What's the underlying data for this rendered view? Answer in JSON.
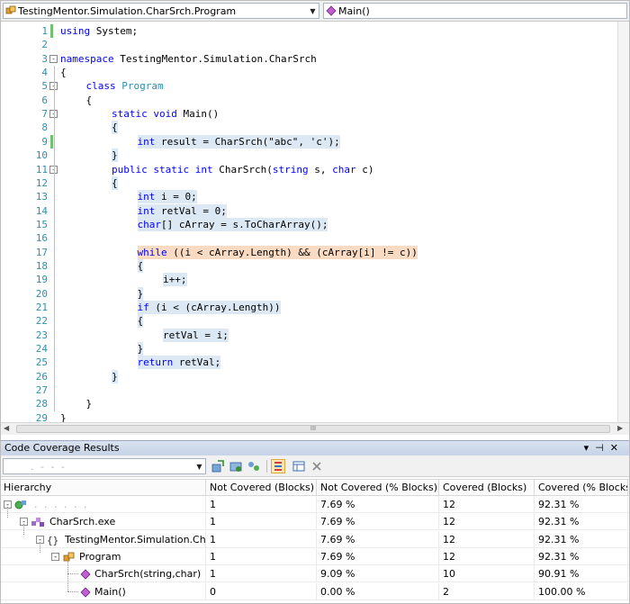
{
  "navbar": {
    "type_selector": "TestingMentor.Simulation.CharSrch.Program",
    "member_selector": "Main()"
  },
  "editor": {
    "lines": [
      {
        "n": "1",
        "text": "using System;",
        "indent": 0,
        "cov": "none"
      },
      {
        "n": "2",
        "text": "",
        "indent": 0,
        "cov": "none"
      },
      {
        "n": "3",
        "text": "namespace TestingMentor.Simulation.CharSrch",
        "indent": 0,
        "cov": "none"
      },
      {
        "n": "4",
        "text": "{",
        "indent": 0,
        "cov": "none"
      },
      {
        "n": "5",
        "text": "class Program",
        "indent": 1,
        "cov": "none"
      },
      {
        "n": "6",
        "text": "{",
        "indent": 1,
        "cov": "none"
      },
      {
        "n": "7",
        "text": "static void Main()",
        "indent": 2,
        "cov": "none"
      },
      {
        "n": "8",
        "text": "{",
        "indent": 2,
        "cov": "covered"
      },
      {
        "n": "9",
        "text": "int result = CharSrch(\"abc\", 'c');",
        "indent": 3,
        "cov": "covered"
      },
      {
        "n": "10",
        "text": "}",
        "indent": 2,
        "cov": "covered"
      },
      {
        "n": "11",
        "text": "public static int CharSrch(string s, char c)",
        "indent": 2,
        "cov": "none"
      },
      {
        "n": "12",
        "text": "{",
        "indent": 2,
        "cov": "covered"
      },
      {
        "n": "13",
        "text": "int i = 0;",
        "indent": 3,
        "cov": "covered"
      },
      {
        "n": "14",
        "text": "int retVal = 0;",
        "indent": 3,
        "cov": "covered"
      },
      {
        "n": "15",
        "text": "char[] cArray = s.ToCharArray();",
        "indent": 3,
        "cov": "covered"
      },
      {
        "n": "16",
        "text": "",
        "indent": 0,
        "cov": "none"
      },
      {
        "n": "17",
        "text": "while ((i < cArray.Length) && (cArray[i] != c))",
        "indent": 3,
        "cov": "partial"
      },
      {
        "n": "18",
        "text": "{",
        "indent": 3,
        "cov": "covered"
      },
      {
        "n": "19",
        "text": "i++;",
        "indent": 4,
        "cov": "covered"
      },
      {
        "n": "20",
        "text": "}",
        "indent": 3,
        "cov": "covered"
      },
      {
        "n": "21",
        "text": "if (i < (cArray.Length))",
        "indent": 3,
        "cov": "covered"
      },
      {
        "n": "22",
        "text": "{",
        "indent": 3,
        "cov": "covered"
      },
      {
        "n": "23",
        "text": "retVal = i;",
        "indent": 4,
        "cov": "covered"
      },
      {
        "n": "24",
        "text": "}",
        "indent": 3,
        "cov": "covered"
      },
      {
        "n": "25",
        "text": "return retVal;",
        "indent": 3,
        "cov": "covered"
      },
      {
        "n": "26",
        "text": "}",
        "indent": 2,
        "cov": "covered"
      },
      {
        "n": "27",
        "text": "",
        "indent": 0,
        "cov": "none"
      },
      {
        "n": "28",
        "text": "}",
        "indent": 1,
        "cov": "none"
      },
      {
        "n": "29",
        "text": "}",
        "indent": 0,
        "cov": "none"
      }
    ]
  },
  "coverage": {
    "title": "Code Coverage Results",
    "toolbar_combo": ". - - -",
    "columns": [
      "Hierarchy",
      "Not Covered (Blocks)",
      "Not Covered (% Blocks)",
      "Covered (Blocks)",
      "Covered (% Blocks)"
    ],
    "rows": [
      {
        "label": ". . . . . .",
        "not_blocks": "1",
        "not_pct": "7.69 %",
        "cov_blocks": "12",
        "cov_pct": "92.31 %"
      },
      {
        "label": "CharSrch.exe",
        "not_blocks": "1",
        "not_pct": "7.69 %",
        "cov_blocks": "12",
        "cov_pct": "92.31 %"
      },
      {
        "label": "TestingMentor.Simulation.CharSrc",
        "not_blocks": "1",
        "not_pct": "7.69 %",
        "cov_blocks": "12",
        "cov_pct": "92.31 %"
      },
      {
        "label": "Program",
        "not_blocks": "1",
        "not_pct": "7.69 %",
        "cov_blocks": "12",
        "cov_pct": "92.31 %"
      },
      {
        "label": "CharSrch(string,char)",
        "not_blocks": "1",
        "not_pct": "9.09 %",
        "cov_blocks": "10",
        "cov_pct": "90.91 %"
      },
      {
        "label": "Main()",
        "not_blocks": "0",
        "not_pct": "0.00 %",
        "cov_blocks": "2",
        "cov_pct": "100.00 %"
      }
    ]
  },
  "colors": {
    "keyword": "#0000ff",
    "type_name": "#2b91af",
    "line_number": "#2b91af",
    "covered_bg": "#dce9f5",
    "partial_bg": "#f9dbc3"
  }
}
